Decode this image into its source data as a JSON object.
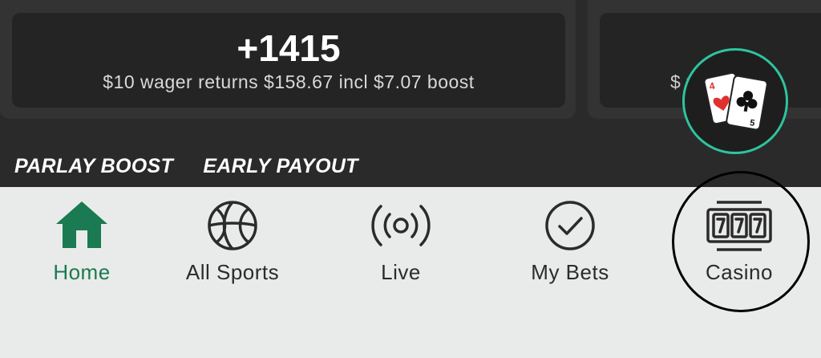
{
  "odds_card": {
    "odds": "+1415",
    "description": "$10 wager returns $158.67 incl $7.07 boost",
    "partial_next": "$   re"
  },
  "tags": [
    "PARLAY BOOST",
    "EARLY PAYOUT"
  ],
  "casino_fab": {
    "icon": "playing-cards-icon",
    "ring_color": "#2ec4a0"
  },
  "nav": {
    "items": [
      {
        "label": "Home",
        "icon": "home-icon",
        "active": true
      },
      {
        "label": "All Sports",
        "icon": "basketball-icon",
        "active": false
      },
      {
        "label": "Live",
        "icon": "live-broadcast-icon",
        "active": false
      },
      {
        "label": "My Bets",
        "icon": "checkmark-circle-icon",
        "active": false
      },
      {
        "label": "Casino",
        "icon": "slot-machine-icon",
        "active": false
      }
    ]
  },
  "colors": {
    "accent": "#1a7a52",
    "dark_bg": "#2a2a2a",
    "nav_bg": "#e9ebea"
  }
}
